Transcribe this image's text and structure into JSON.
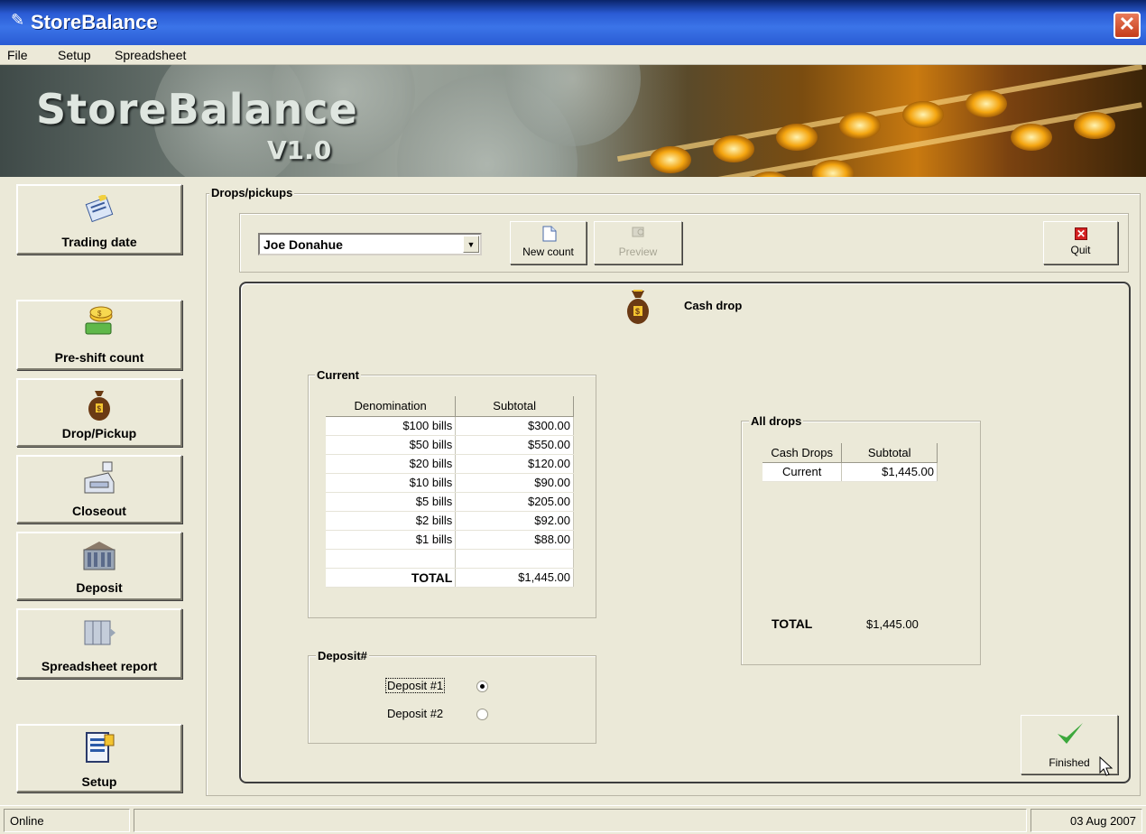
{
  "window": {
    "title": "StoreBalance",
    "close_glyph": "✕"
  },
  "menu": [
    "File",
    "Setup",
    "Spreadsheet"
  ],
  "banner": {
    "logo": "StoreBalance",
    "version": "V1.0"
  },
  "sidebar": [
    {
      "label": "Trading date",
      "icon": "calendar-icon"
    },
    {
      "label": "Pre-shift count",
      "icon": "coins-icon"
    },
    {
      "label": "Drop/Pickup",
      "icon": "money-bag-icon"
    },
    {
      "label": "Closeout",
      "icon": "cash-register-icon"
    },
    {
      "label": "Deposit",
      "icon": "bank-icon"
    },
    {
      "label": "Spreadsheet report",
      "icon": "spreadsheet-icon"
    },
    {
      "label": "Setup",
      "icon": "setup-icon"
    }
  ],
  "drops": {
    "group_label": "Drops/pickups",
    "employee": "Joe Donahue",
    "new_count_label": "New count",
    "preview_label": "Preview",
    "quit_label": "Quit",
    "panel_title": "Cash drop"
  },
  "current": {
    "group_label": "Current",
    "headers": [
      "Denomination",
      "Subtotal"
    ],
    "rows": [
      [
        "$100 bills",
        "$300.00"
      ],
      [
        "$50 bills",
        "$550.00"
      ],
      [
        "$20 bills",
        "$120.00"
      ],
      [
        "$10 bills",
        "$90.00"
      ],
      [
        "$5 bills",
        "$205.00"
      ],
      [
        "$2 bills",
        "$92.00"
      ],
      [
        "$1 bills",
        "$88.00"
      ],
      [
        "",
        ""
      ]
    ],
    "total_label": "TOTAL",
    "total_value": "$1,445.00"
  },
  "all_drops": {
    "group_label": "All drops",
    "headers": [
      "Cash Drops",
      "Subtotal"
    ],
    "rows": [
      [
        "Current",
        "$1,445.00"
      ]
    ],
    "total_label": "TOTAL",
    "total_value": "$1,445.00"
  },
  "deposit": {
    "group_label": "Deposit#",
    "options": [
      "Deposit #1",
      "Deposit #2"
    ],
    "selected": "Deposit #1"
  },
  "finished_label": "Finished",
  "status": {
    "left": "Online",
    "right": "03 Aug 2007"
  }
}
